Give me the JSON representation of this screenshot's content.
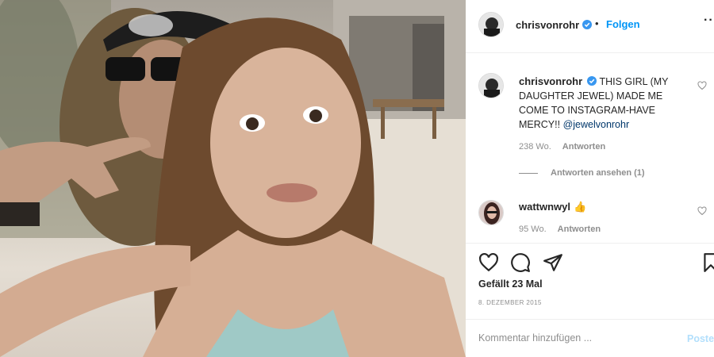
{
  "photo": {
    "alt_subject": "selfie"
  },
  "header": {
    "username": "chrisvonrohr",
    "separator": "•",
    "follow_label": "Folgen",
    "more_icon": "more-dots-icon"
  },
  "caption": {
    "username": "chrisvonrohr",
    "text": "THIS GIRL (MY DAUGHTER JEWEL) MADE ME COME TO INSTAGRAM-HAVE MERCY!! ",
    "mention": "@jewelvonrohr",
    "age": "238 Wo.",
    "reply_label": "Antworten",
    "view_replies": "Antworten ansehen (1)"
  },
  "comment": {
    "username": "wattwnwyl",
    "emoji": "👍",
    "age": "95 Wo.",
    "reply_label": "Antworten"
  },
  "actions": {
    "like_icon": "heart-icon",
    "comment_icon": "comment-icon",
    "share_icon": "share-icon",
    "save_icon": "bookmark-icon"
  },
  "likes": "Gefällt 23 Mal",
  "date": "8. DEZEMBER 2015",
  "comment_box": {
    "placeholder": "Kommentar hinzufügen ...",
    "post_label": "Posten"
  },
  "colors": {
    "link_blue": "#0095f6",
    "muted": "#8e8e8e",
    "text": "#262626",
    "verified": "#3897f0"
  }
}
